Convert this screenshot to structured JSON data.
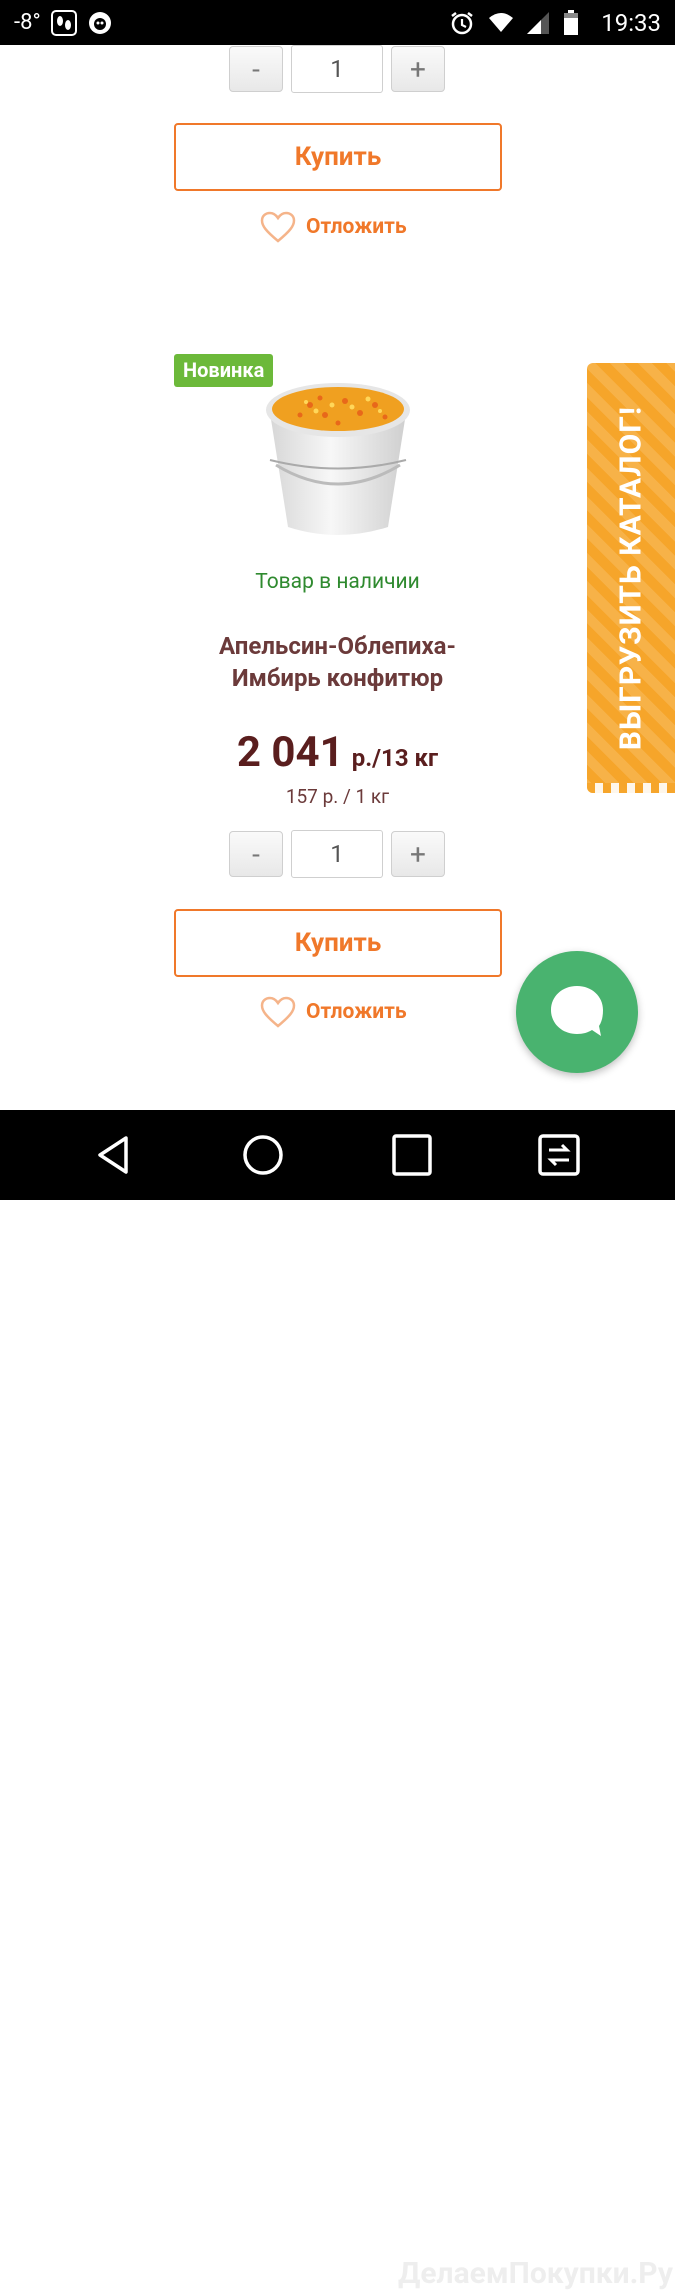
{
  "status_bar": {
    "temperature": "-8°",
    "time": "19:33",
    "icons": [
      "footprints-icon",
      "dr-web-icon",
      "alarm-icon",
      "wifi-icon",
      "signal-icon",
      "battery-icon"
    ]
  },
  "top_product": {
    "quantity": "1",
    "buy_label": "Купить",
    "defer_label": "Отложить"
  },
  "product": {
    "badge": "Новинка",
    "stock": "Товар в наличии",
    "name_line1": "Апельсин-Облепиха-",
    "name_line2": "Имбирь конфитюр",
    "price_value": "2 041",
    "price_unit": "р./13 кг",
    "unit_price": "157 р. / 1 кг",
    "quantity": "1",
    "buy_label": "Купить",
    "defer_label": "Отложить"
  },
  "qty_controls": {
    "minus": "-",
    "plus": "+"
  },
  "side_banner": {
    "label": "ВЫГРУЗИТЬ КАТАЛОГ!"
  },
  "nav": {
    "icons": [
      "back-icon",
      "home-icon",
      "recents-icon",
      "switch-app-icon"
    ]
  },
  "watermark": "ДелаемПокупки.Ру",
  "colors": {
    "accent": "#f0782a",
    "badge": "#6cb93a",
    "stock": "#2f8a2f",
    "chat": "#49b36f",
    "banner": "#f6a52a",
    "price": "#5a1e1e"
  }
}
